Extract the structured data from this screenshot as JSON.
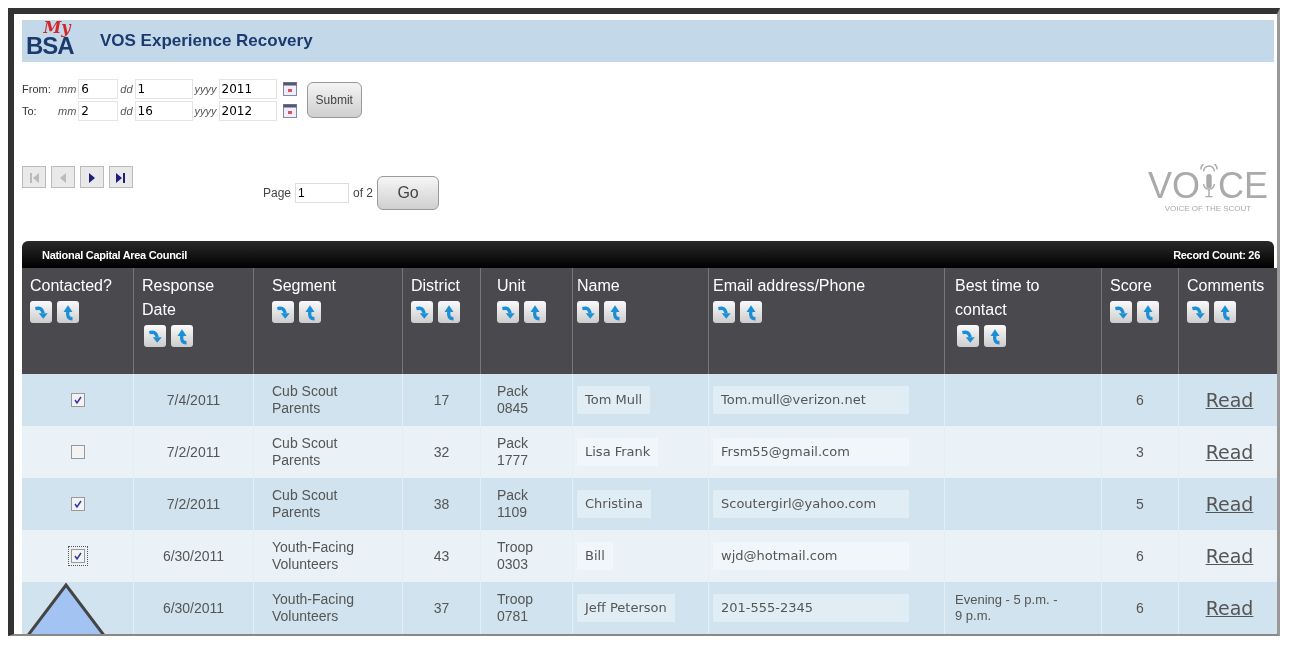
{
  "app": {
    "title": "VOS Experience Recovery",
    "logo": {
      "top": "My",
      "bottom": "BSA"
    }
  },
  "date_filter": {
    "rows": [
      {
        "label": "From:",
        "fields": [
          {
            "unit": "mm",
            "value": "6"
          },
          {
            "unit": "dd",
            "value": "1"
          },
          {
            "unit": "yyyy",
            "value": "2011"
          }
        ]
      },
      {
        "label": "To:",
        "fields": [
          {
            "unit": "mm",
            "value": "2"
          },
          {
            "unit": "dd",
            "value": "16"
          },
          {
            "unit": "yyyy",
            "value": "2012"
          }
        ]
      }
    ],
    "submit": "Submit"
  },
  "pager": {
    "buttons": [
      {
        "kind": "first",
        "disabled": true
      },
      {
        "kind": "prev",
        "disabled": true
      },
      {
        "kind": "next",
        "disabled": false
      },
      {
        "kind": "last",
        "disabled": false
      }
    ],
    "page_label": "Page",
    "page_value": "1",
    "of_label": "of 2",
    "go": "Go"
  },
  "voice_logo": {
    "left": "VO",
    "right": "CE",
    "tagline": "VOICE OF THE SCOUT"
  },
  "table": {
    "title": "National Capital Area Council",
    "record_count": "Record Count: 26",
    "columns": [
      "Contacted?",
      "Response Date",
      "Segment",
      "District",
      "Unit",
      "Name",
      "Email address/Phone",
      "Best time to contact",
      "Score",
      "Comments"
    ],
    "rows": [
      {
        "checked": true,
        "date": "7/4/2011",
        "segment": "Cub Scout Parents",
        "district": "17",
        "unit": "Pack 0845",
        "name": "Tom Mull",
        "contact": "Tom.mull@verizon.net",
        "score": "6",
        "comments": "Read"
      },
      {
        "checked": false,
        "date": "7/2/2011",
        "segment": "Cub Scout Parents",
        "district": "32",
        "unit": "Pack 1777",
        "name": "Lisa Frank",
        "contact": "Frsm55@gmail.com",
        "score": "3",
        "comments": "Read"
      },
      {
        "checked": true,
        "date": "7/2/2011",
        "segment": "Cub Scout Parents",
        "district": "38",
        "unit": "Pack 1109",
        "name": "Christina",
        "contact": "Scoutergirl@yahoo.com",
        "score": "5",
        "comments": "Read"
      },
      {
        "checked": true,
        "date": "6/30/2011",
        "segment": "Youth-Facing Volunteers",
        "district": "43",
        "unit": "Troop 0303",
        "name": "Bill",
        "contact": "wjd@hotmail.com",
        "score": "6",
        "comments": "Read"
      },
      {
        "date": "6/30/2011",
        "segment": "Youth-Facing Volunteers",
        "district": "37",
        "unit": "Troop 0781",
        "name": "Jeff Peterson",
        "contact": "201-555-2345",
        "best_time": "Evening - 5 p.m. - 9 p.m.",
        "score": "6",
        "comments": "Read"
      }
    ]
  }
}
